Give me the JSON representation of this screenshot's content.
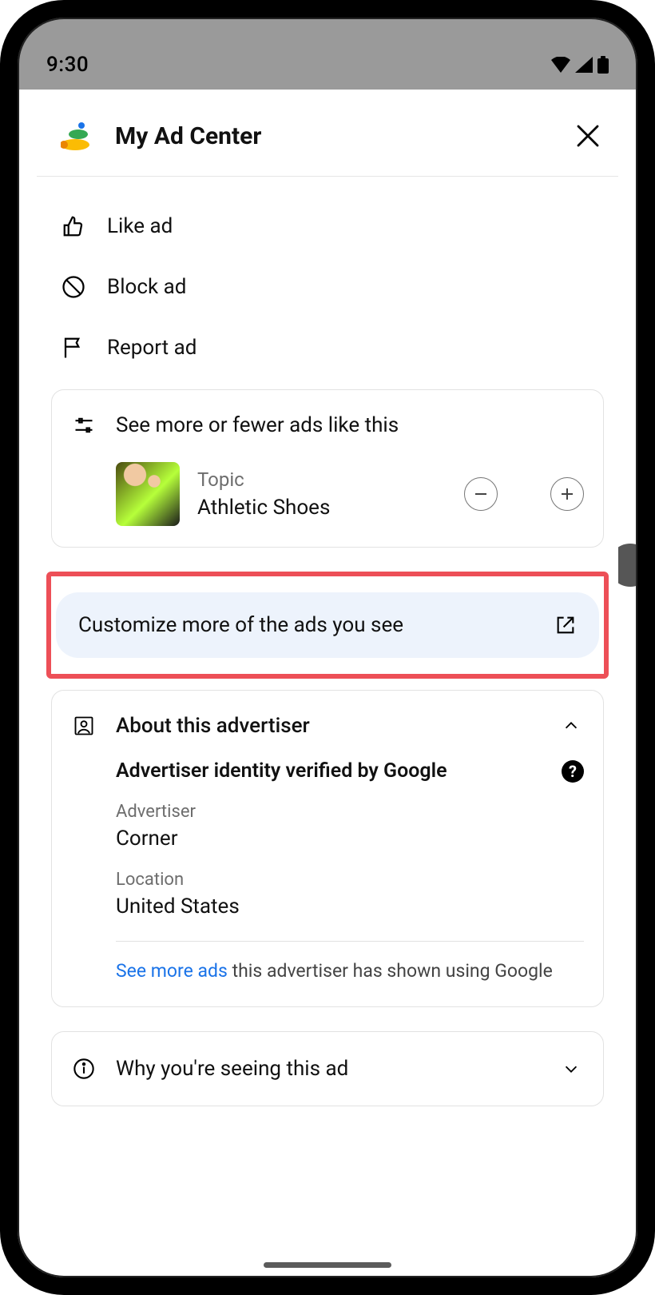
{
  "status": {
    "time": "9:30"
  },
  "header": {
    "title": "My Ad Center"
  },
  "actions": {
    "like": "Like ad",
    "block": "Block ad",
    "report": "Report ad"
  },
  "topics_card": {
    "title": "See more or fewer ads like this",
    "topic_label": "Topic",
    "topic_name": "Athletic Shoes"
  },
  "customize": {
    "label": "Customize more of the ads you see"
  },
  "advertiser_card": {
    "title": "About this advertiser",
    "verified": "Advertiser identity verified by Google",
    "advertiser_label": "Advertiser",
    "advertiser_value": "Corner",
    "location_label": "Location",
    "location_value": "United States",
    "see_more_link": "See more ads",
    "see_more_rest": " this advertiser has shown using Google"
  },
  "why_card": {
    "title": "Why you're seeing this ad"
  }
}
